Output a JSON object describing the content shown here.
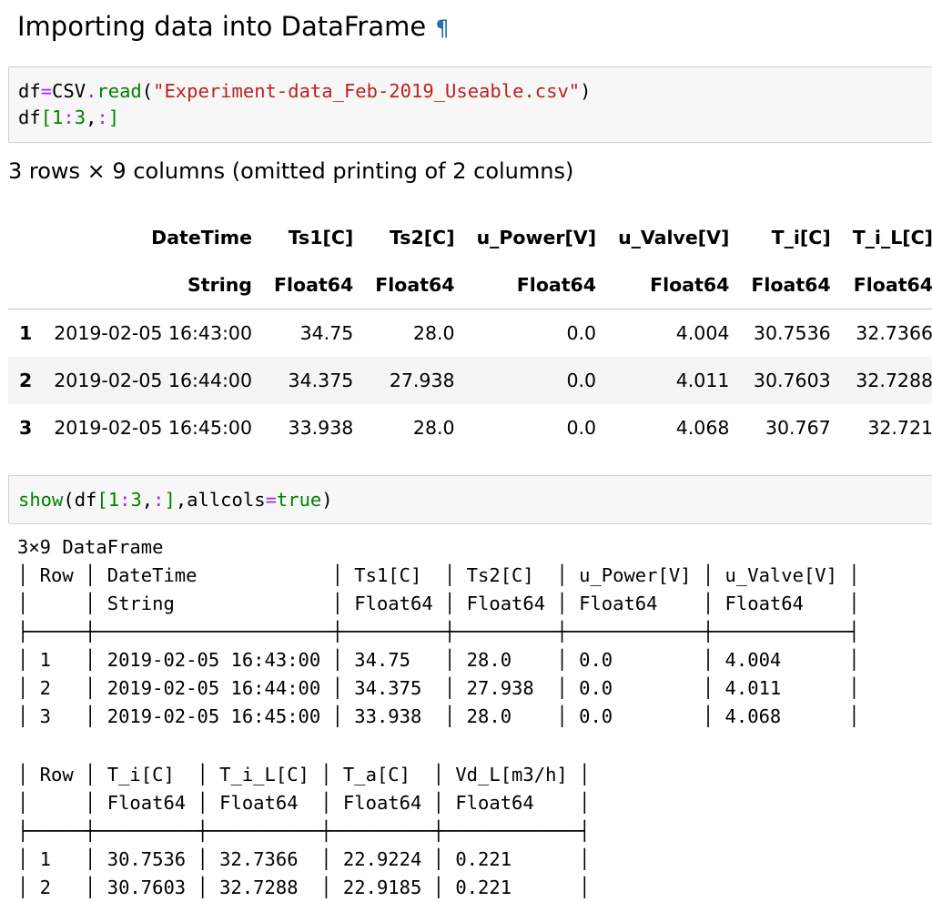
{
  "heading": {
    "title": "Importing data into DataFrame",
    "anchor": "¶"
  },
  "cell1": {
    "line1": {
      "var": "df",
      "op": "=",
      "obj": "CSV",
      "dot": ".",
      "method": "read",
      "open": "(",
      "arg": "\"Experiment-data_Feb-2019_Useable.csv\"",
      "close": ")"
    },
    "line2": {
      "var": "df",
      "open": "[",
      "n1": "1",
      "colon1": ":",
      "n2": "3",
      "comma": ",",
      "colon2": ":",
      "close": "]"
    }
  },
  "summary": "3 rows × 9 columns (omitted printing of 2 columns)",
  "table": {
    "headers": [
      "DateTime",
      "Ts1[C]",
      "Ts2[C]",
      "u_Power[V]",
      "u_Valve[V]",
      "T_i[C]",
      "T_i_L[C]"
    ],
    "types": [
      "String",
      "Float64",
      "Float64",
      "Float64",
      "Float64",
      "Float64",
      "Float64"
    ],
    "rows": [
      [
        "1",
        "2019-02-05 16:43:00",
        "34.75",
        "28.0",
        "0.0",
        "4.004",
        "30.7536",
        "32.7366"
      ],
      [
        "2",
        "2019-02-05 16:44:00",
        "34.375",
        "27.938",
        "0.0",
        "4.011",
        "30.7603",
        "32.7288"
      ],
      [
        "3",
        "2019-02-05 16:45:00",
        "33.938",
        "28.0",
        "0.0",
        "4.068",
        "30.767",
        "32.721"
      ]
    ]
  },
  "cell2": {
    "func": "show",
    "open": "(",
    "var": "df",
    "idx_open": "[",
    "n1": "1",
    "colon1": ":",
    "n2": "3",
    "comma1": ",",
    "colon2": ":",
    "idx_close": "]",
    "comma2": ",",
    "kwarg": "allcols",
    "eq": "=",
    "value": "true",
    "close": ")"
  },
  "output1": "3×9 DataFrame\n│ Row │ DateTime            │ Ts1[C]  │ Ts2[C]  │ u_Power[V] │ u_Valve[V] │\n│     │ String              │ Float64 │ Float64 │ Float64    │ Float64    │\n├─────┼─────────────────────┼─────────┼─────────┼────────────┼────────────┤\n│ 1   │ 2019-02-05 16:43:00 │ 34.75   │ 28.0    │ 0.0        │ 4.004      │\n│ 2   │ 2019-02-05 16:44:00 │ 34.375  │ 27.938  │ 0.0        │ 4.011      │\n│ 3   │ 2019-02-05 16:45:00 │ 33.938  │ 28.0    │ 0.0        │ 4.068      │",
  "output2": "│ Row │ T_i[C]  │ T_i_L[C] │ T_a[C]  │ Vd_L[m3/h] │\n│     │ Float64 │ Float64  │ Float64 │ Float64    │\n├─────┼─────────┼──────────┼─────────┼────────────┤\n│ 1   │ 30.7536 │ 32.7366  │ 22.9224 │ 0.221      │\n│ 2   │ 30.7603 │ 32.7288  │ 22.9185 │ 0.221      │"
}
